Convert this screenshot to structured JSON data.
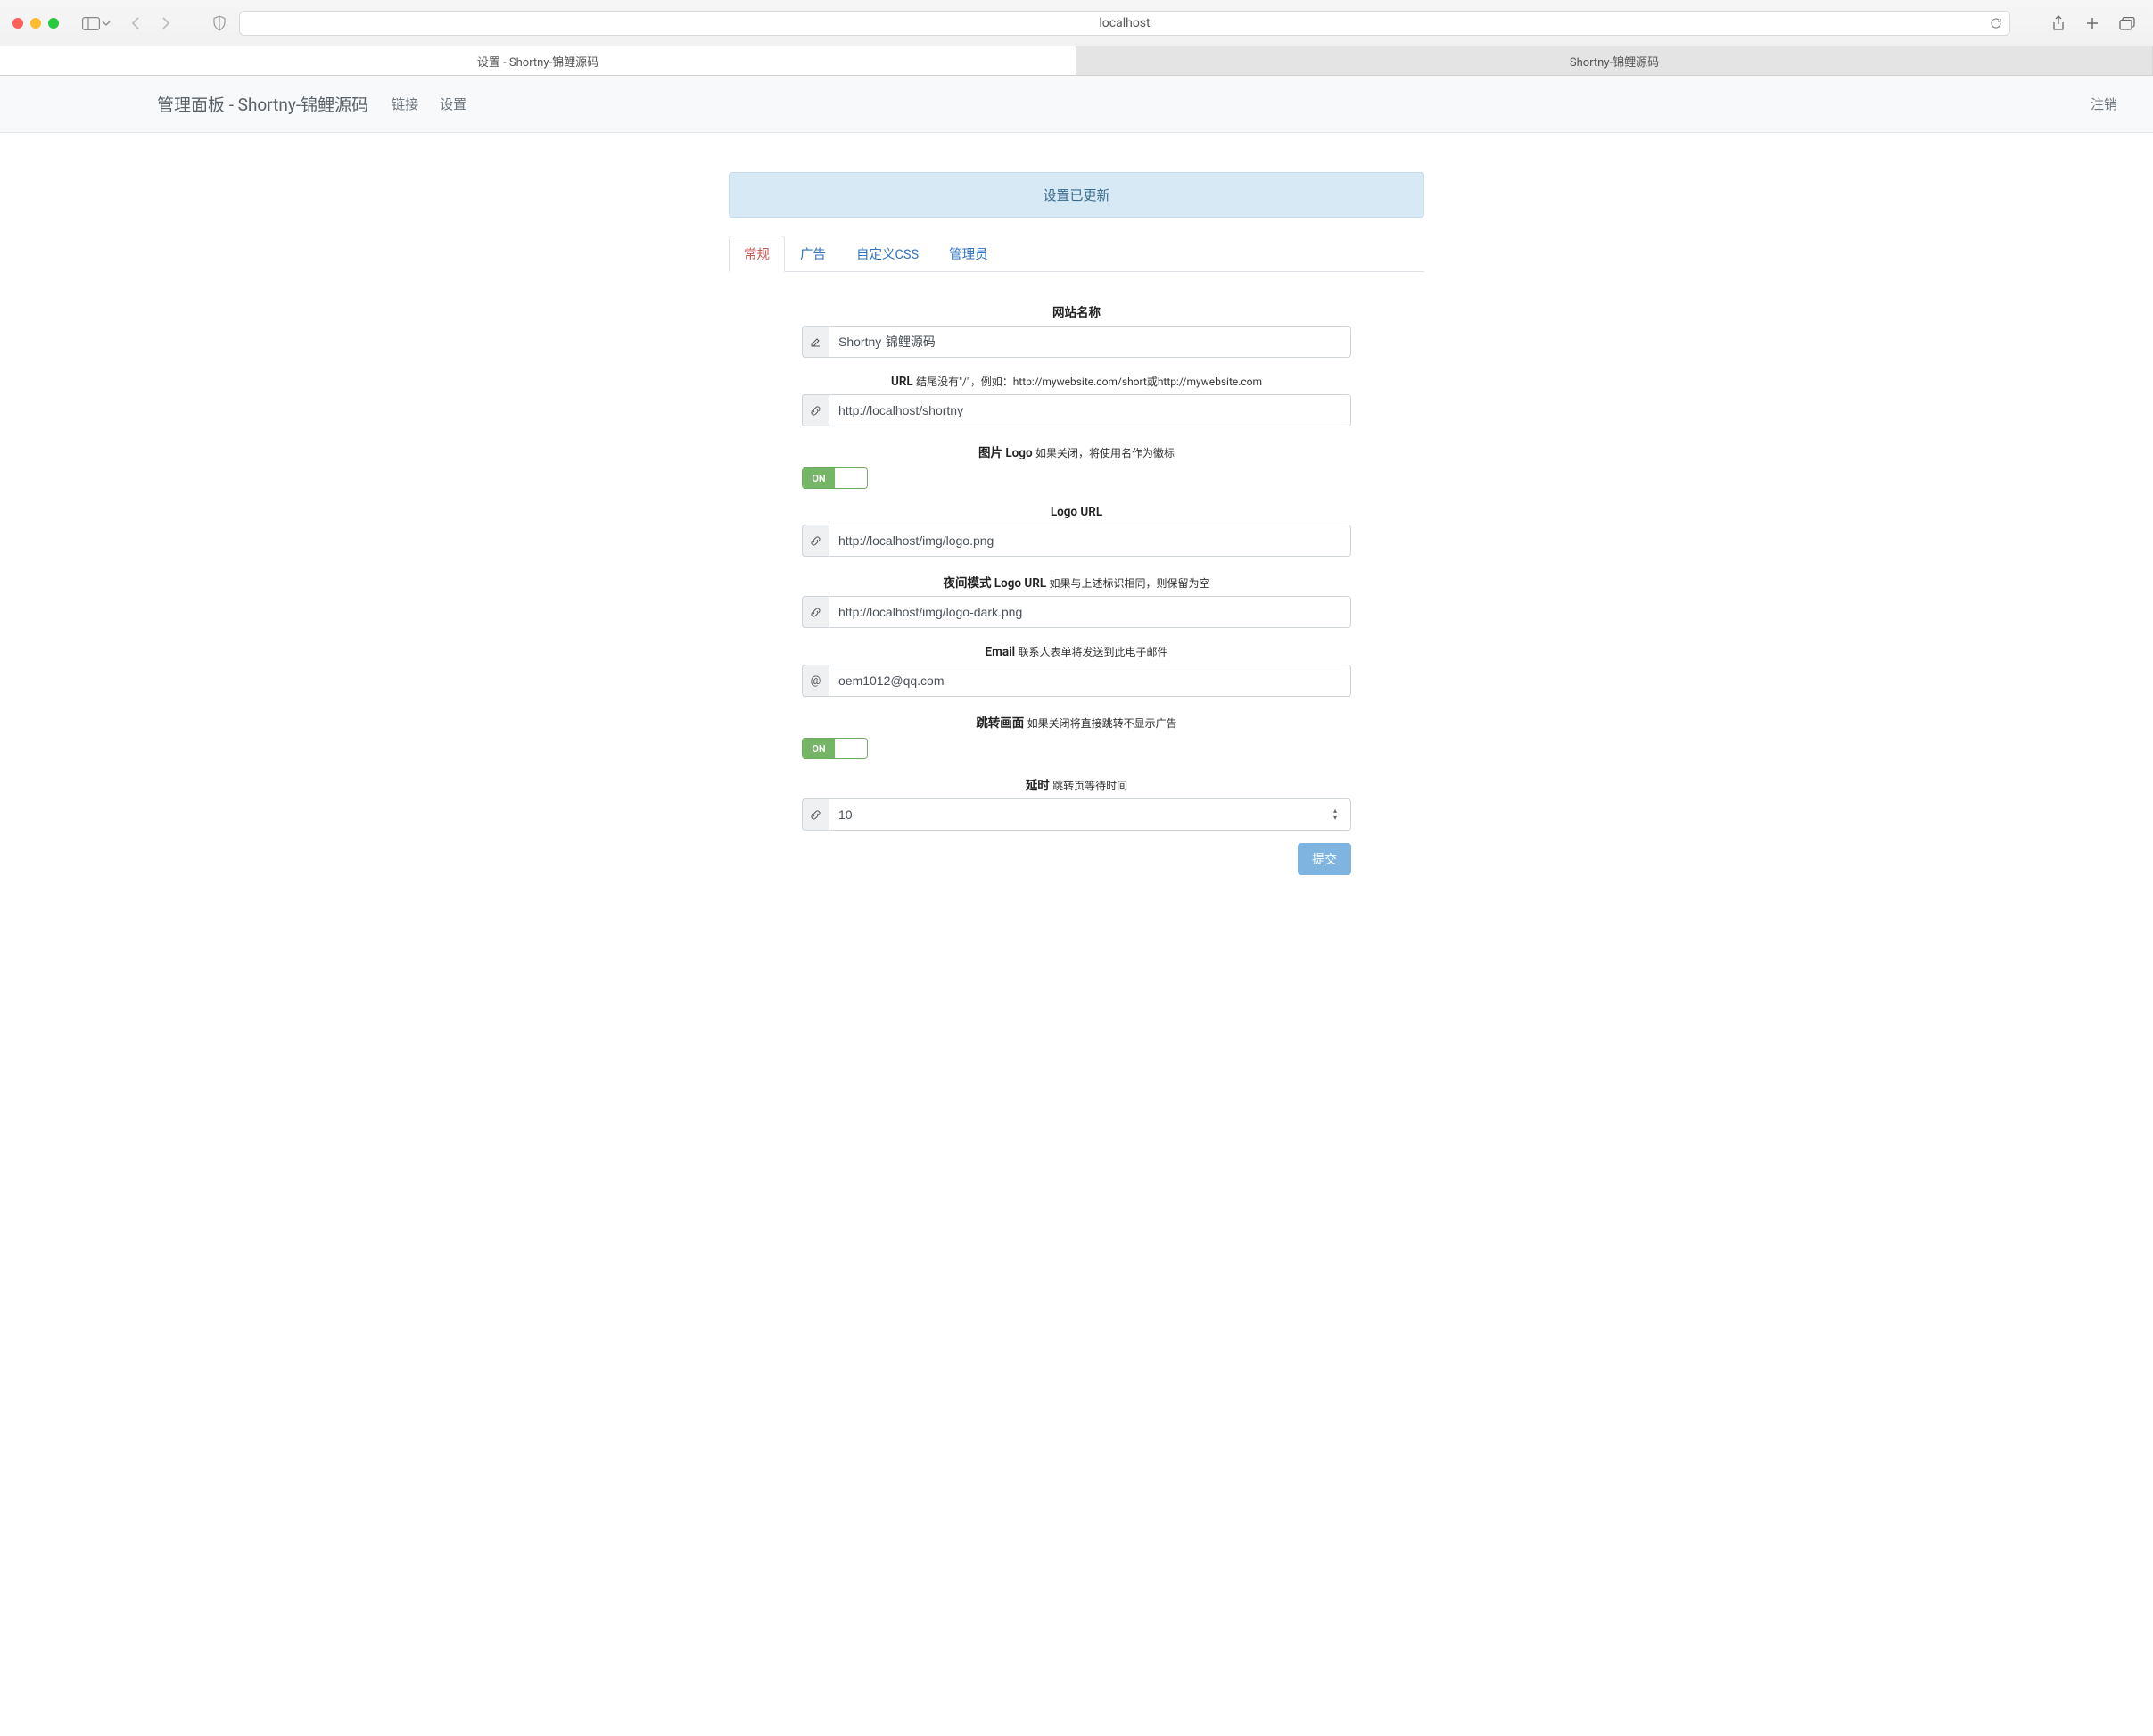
{
  "browser": {
    "address": "localhost",
    "tabs": [
      {
        "title": "设置 - Shortny-锦鲤源码",
        "active": true
      },
      {
        "title": "Shortny-锦鲤源码",
        "active": false
      }
    ]
  },
  "navbar": {
    "brand": "管理面板 - Shortny-锦鲤源码",
    "links": {
      "label": "链接"
    },
    "settings": {
      "label": "设置"
    },
    "logout": {
      "label": "注销"
    }
  },
  "alert": {
    "text": "设置已更新"
  },
  "tabs": [
    {
      "id": "general",
      "label": "常规",
      "active": true
    },
    {
      "id": "ads",
      "label": "广告",
      "active": false
    },
    {
      "id": "css",
      "label": "自定义CSS",
      "active": false
    },
    {
      "id": "admin",
      "label": "管理员",
      "active": false
    }
  ],
  "form": {
    "site_name": {
      "label": "网站名称",
      "value": "Shortny-锦鲤源码"
    },
    "url": {
      "label": "URL",
      "hint": "结尾没有\"/\"，例如：http://mywebsite.com/short或http://mywebsite.com",
      "value": "http://localhost/shortny"
    },
    "image_logo": {
      "label": "图片 Logo",
      "hint": "如果关闭，将使用名作为徽标",
      "toggle": "ON"
    },
    "logo_url": {
      "label": "Logo URL",
      "value": "http://localhost/img/logo.png"
    },
    "dark_logo_url": {
      "label": "夜间模式 Logo URL",
      "hint": "如果与上述标识相同，则保留为空",
      "value": "http://localhost/img/logo-dark.png"
    },
    "email": {
      "label": "Email",
      "hint": "联系人表单将发送到此电子邮件",
      "value": "oem1012@qq.com"
    },
    "splash": {
      "label": "跳转画面",
      "hint": "如果关闭将直接跳转不显示广告",
      "toggle": "ON"
    },
    "delay": {
      "label": "延时",
      "hint": "跳转页等待时间",
      "value": "10"
    },
    "submit_label": "提交"
  }
}
